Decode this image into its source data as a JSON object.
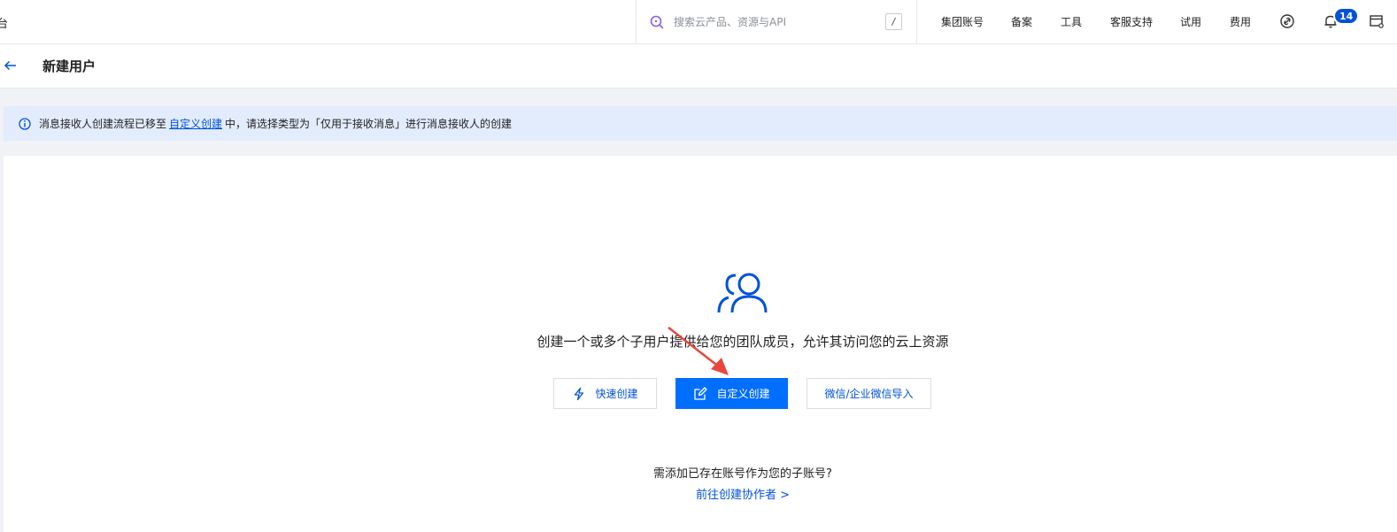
{
  "topbar": {
    "brand_stub": "台",
    "search": {
      "placeholder": "搜索云产品、资源与API",
      "shortcut": "/"
    },
    "nav": [
      "集团账号",
      "备案",
      "工具",
      "客服支持",
      "试用",
      "费用"
    ],
    "notification_count": "14",
    "icons": [
      "search-icon",
      "link-icon",
      "bell-icon",
      "settings-window-icon"
    ]
  },
  "page": {
    "title": "新建用户",
    "back_icon": "arrow-left-icon"
  },
  "notice": {
    "text_before": "消息接收人创建流程已移至",
    "link": "自定义创建",
    "text_after": "中，请选择类型为「仅用于接收消息」进行消息接收人的创建"
  },
  "main": {
    "lead": "创建一个或多个子用户提供给您的团队成员，允许其访问您的云上资源",
    "buttons": {
      "quick": "快速创建",
      "custom": "自定义创建",
      "wechat": "微信/企业微信导入"
    },
    "sub_question": "需添加已存在账号作为您的子账号?",
    "sub_link": "前往创建协作者 >"
  },
  "colors": {
    "primary": "#0052d9",
    "button_primary": "#006eff",
    "notice_bg": "#e3ecfd",
    "annotation": "#e8473f"
  }
}
